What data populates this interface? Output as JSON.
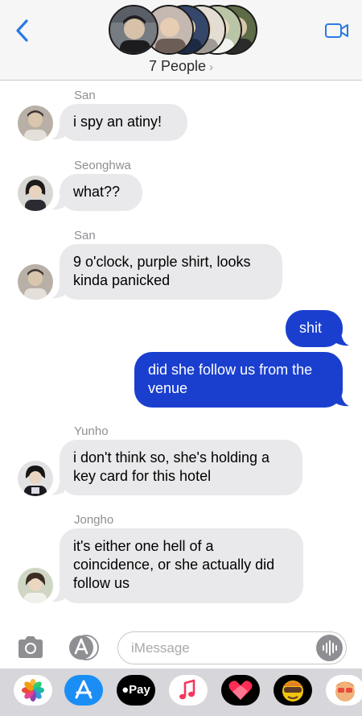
{
  "header": {
    "group_name": "7 People",
    "chevron": "›",
    "back_icon": "chevron-left-icon",
    "video_icon": "video-camera-icon",
    "accent": "#2a7ae2"
  },
  "messages": [
    {
      "sender": "San",
      "direction": "in",
      "lines": [
        "i spy an atiny!"
      ]
    },
    {
      "sender": "Seonghwa",
      "direction": "in",
      "lines": [
        "what??"
      ]
    },
    {
      "sender": "San",
      "direction": "in",
      "lines": [
        "9 o'clock, purple shirt, looks",
        "kinda panicked"
      ]
    },
    {
      "sender": "",
      "direction": "out",
      "lines": [
        "shit"
      ]
    },
    {
      "sender": "",
      "direction": "out",
      "lines": [
        "did she follow us from the",
        "venue"
      ]
    },
    {
      "sender": "Yunho",
      "direction": "in",
      "lines": [
        "i don't think so, she's holding a",
        "key card for this hotel"
      ]
    },
    {
      "sender": "Jongho",
      "direction": "in",
      "lines": [
        "it's either one hell of a",
        "coincidence, or she actually did",
        "follow us"
      ]
    }
  ],
  "input": {
    "placeholder": "iMessage",
    "value": ""
  },
  "toolbar": {
    "camera_icon": "camera-icon",
    "apps_icon": "app-store-icon",
    "audio_icon": "audio-waveform-icon"
  },
  "drawer": {
    "apps": [
      "photos-icon",
      "app-store-icon",
      "apple-pay-icon",
      "music-icon",
      "digital-touch-icon",
      "memoji-icon",
      "memoji-stickers-icon"
    ],
    "pay_label": "Pay"
  },
  "colors": {
    "incoming_bubble": "#e9e9eb",
    "outgoing_bubble": "#1a3fcf",
    "header_bg": "#f6f6f6",
    "drawer_bg": "#d6d6db"
  }
}
